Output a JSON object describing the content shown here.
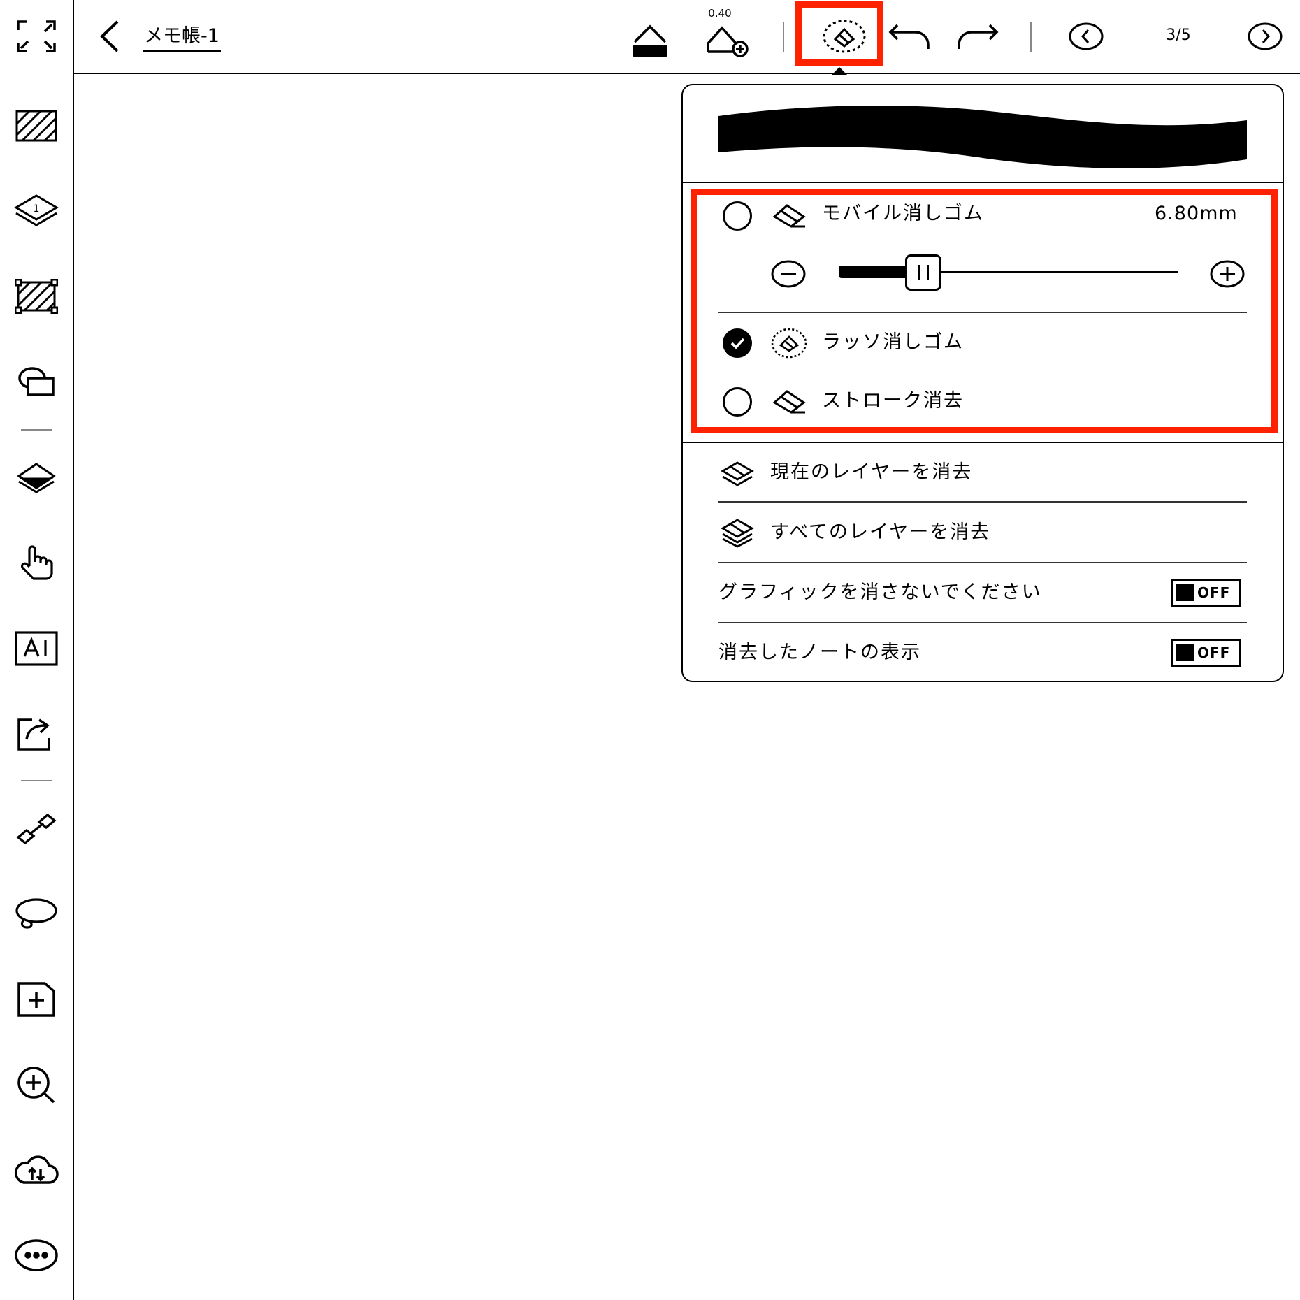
{
  "header": {
    "title": "メモ帳-1",
    "pen_width": "0.40",
    "page_indicator": "3/5"
  },
  "sidebar": {
    "items": [
      {
        "icon": "hatch-pattern-icon"
      },
      {
        "icon": "layer-icon"
      },
      {
        "icon": "template-crop-icon"
      },
      {
        "icon": "shapes-icon"
      },
      {
        "icon": "fill-layer-icon"
      },
      {
        "icon": "hand-touch-icon"
      },
      {
        "icon": "ai-icon"
      },
      {
        "icon": "share-icon"
      },
      {
        "icon": "link-icon"
      },
      {
        "icon": "lasso-icon"
      },
      {
        "icon": "add-page-icon"
      },
      {
        "icon": "zoom-in-icon"
      },
      {
        "icon": "cloud-sync-icon"
      },
      {
        "icon": "more-icon"
      }
    ],
    "layer_number": "1"
  },
  "eraser_panel": {
    "options": [
      {
        "label": "モバイル消しゴム",
        "selected": false
      },
      {
        "label": "ラッソ消しゴム",
        "selected": true
      },
      {
        "label": "ストローク消去",
        "selected": false
      }
    ],
    "size_value": "6.80mm",
    "slider_level": 0.22,
    "actions": [
      {
        "label": "現在のレイヤーを消去"
      },
      {
        "label": "すべてのレイヤーを消去"
      }
    ],
    "toggles": [
      {
        "label": "グラフィックを消さないでください",
        "state": "OFF"
      },
      {
        "label": "消去したノートの表示",
        "state": "OFF"
      }
    ]
  },
  "colors": {
    "highlight": "#ff2200",
    "ink": "#000000"
  }
}
